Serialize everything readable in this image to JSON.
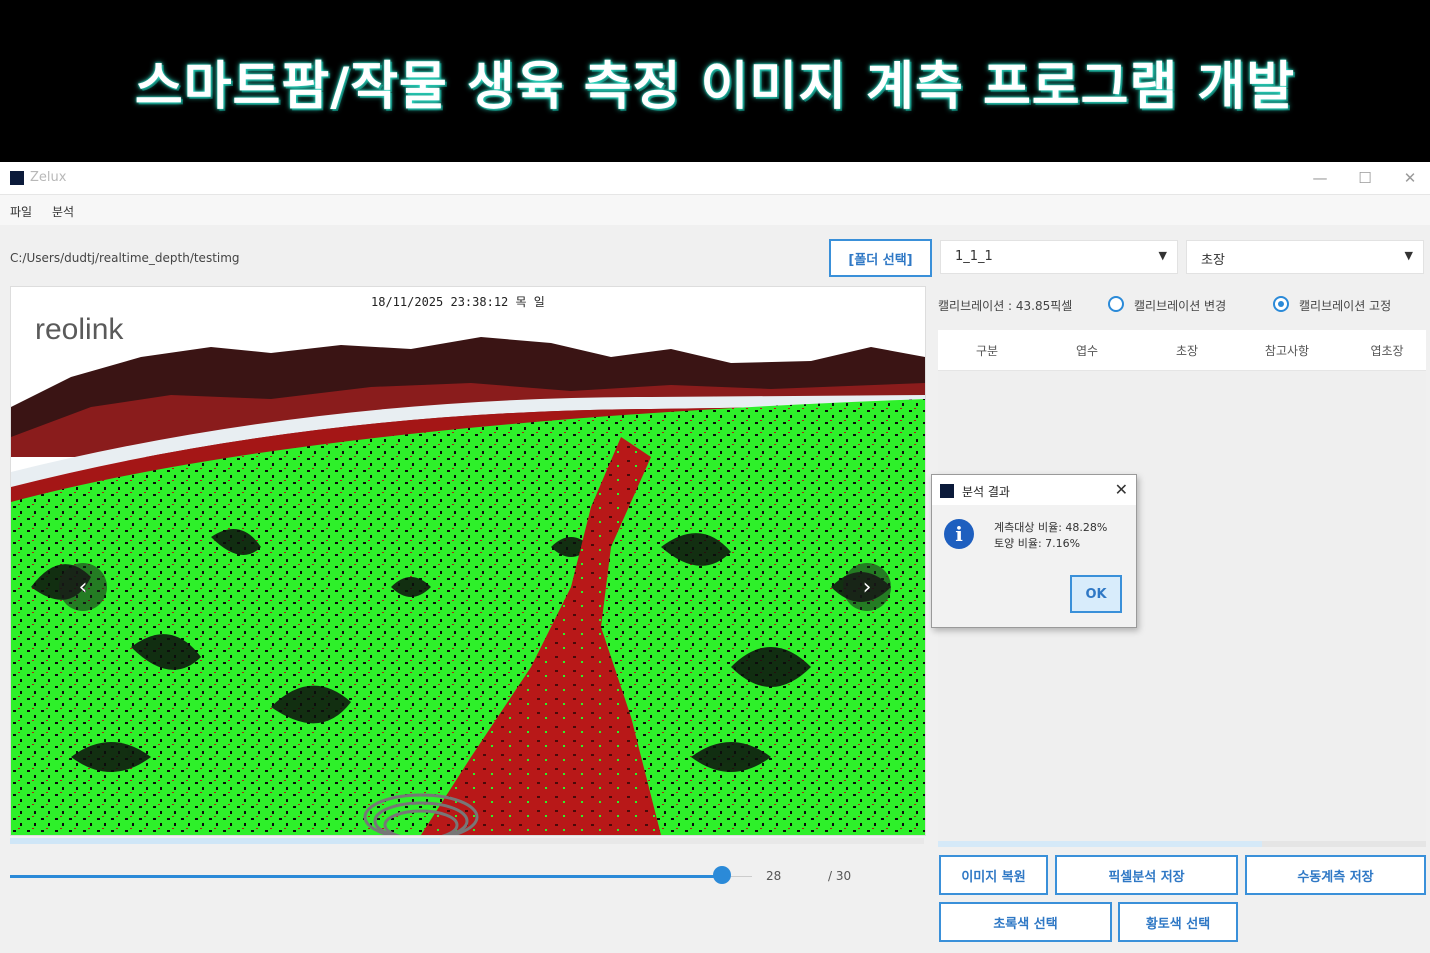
{
  "banner": {
    "title": "스마트팜/작물 생육 측정 이미지 계측 프로그램 개발"
  },
  "window": {
    "app_name": "Zelux",
    "controls": {
      "minimize": "—",
      "maximize": "☐",
      "close": "✕"
    }
  },
  "menu": {
    "items": [
      "파일",
      "분석"
    ]
  },
  "toolbar": {
    "path": "C:/Users/dudtj/realtime_depth/testimg",
    "folder_button": "[폴더 선택]",
    "dropdown1_value": "1_1_1",
    "dropdown2_value": "초장",
    "dropdown_arrow": "▼"
  },
  "image": {
    "timestamp": "18/11/2025 23:38:12 목 일",
    "logo": "reolink",
    "prev_icon": "‹",
    "next_icon": "›"
  },
  "slider": {
    "value": 28,
    "total_label": "/ 30",
    "current_label": "28",
    "fraction": 0.9333
  },
  "calibration": {
    "label": "캘리브레이션 : 43.85픽셀",
    "option_change": "캘리브레이션 변경",
    "option_fix": "캘리브레이션 고정",
    "selected": "fix"
  },
  "table": {
    "columns": [
      "구분",
      "엽수",
      "초장",
      "참고사항",
      "엽초장"
    ]
  },
  "buttons": {
    "restore_image": "이미지 복원",
    "save_pixel_analysis": "픽셀분석 저장",
    "save_manual_measure": "수동계측 저장",
    "select_green": "초록색 선택",
    "select_yellow_soil": "황토색 선택"
  },
  "dialog": {
    "title": "분석 결과",
    "close": "✕",
    "info_icon": "i",
    "line1": "계측대상 비율: 48.28%",
    "line2": "토양 비율: 7.16%",
    "ok": "OK"
  },
  "colors": {
    "accent": "#2b8ad8",
    "banner_glow": "#2fe0c8",
    "mask_green": "#2ef02a",
    "mask_red": "#b81818"
  }
}
